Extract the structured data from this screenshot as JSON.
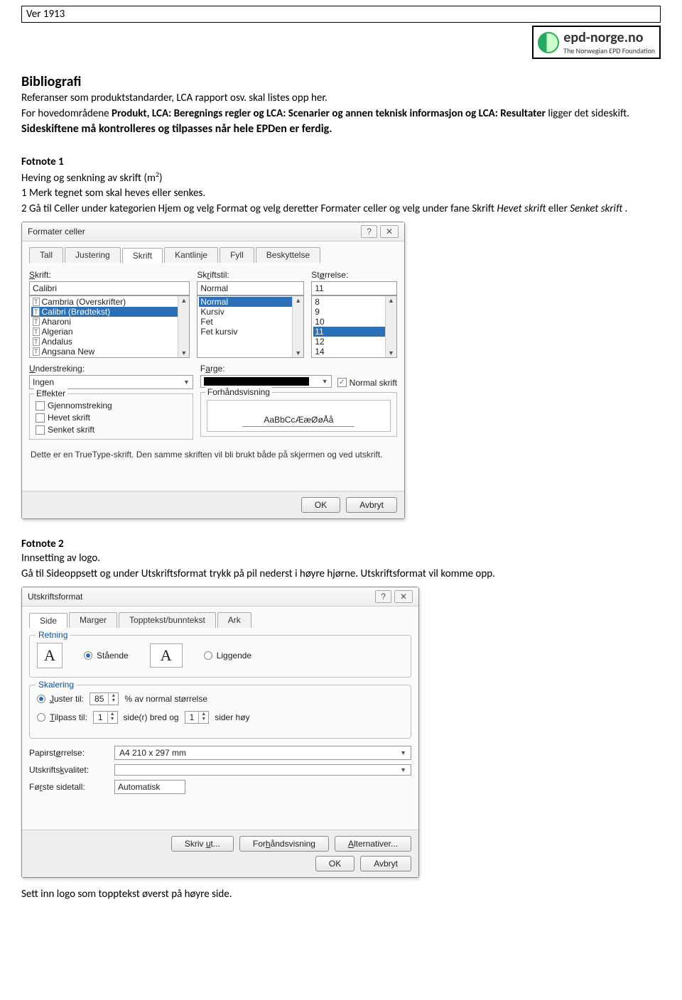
{
  "version": "Ver 1913",
  "logo": {
    "main": "epd-norge.no",
    "sub": "The Norwegian EPD Foundation"
  },
  "bibliografi": {
    "title": "Bibliografi",
    "p1": "Referanser som produktstandarder, LCA rapport osv. skal listes opp her.",
    "p2_a": "For hovedområdene ",
    "p2_b": "Produkt, LCA: Beregnings regler og LCA: Scenarier og annen teknisk informasjon og LCA: Resultater",
    "p2_c": " ligger det sideskift.",
    "boldline": "Sideskiftene må kontrolleres og tilpasses når hele EPDen er ferdig."
  },
  "fotnote1": {
    "title": "Fotnote 1",
    "line1_a": "Heving og senkning av skrift    (m",
    "line1_sup": "2",
    "line1_b": ")",
    "step1": "1 Merk tegnet som skal heves eller senkes.",
    "step2_a": "2 Gå til Celler under kategorien Hjem og velg Format og velg deretter Formater celler og velg under fane Skrift ",
    "step2_b": "Hevet skrift",
    "step2_c": "  eller ",
    "step2_d": "Senket skrift",
    "step2_e": " ."
  },
  "dialog1": {
    "title": "Formater celler",
    "tabs": {
      "tall": "Tall",
      "justering": "Justering",
      "skrift": "Skrift",
      "kantlinje": "Kantlinje",
      "fyll": "Fyll",
      "beskyttelse": "Beskyttelse"
    },
    "skrift_label": "Skrift:",
    "skrift_value": "Calibri",
    "font_list": [
      "Cambria (Overskrifter)",
      "Calibri (Brødtekst)",
      "Aharoni",
      "Algerian",
      "Andalus",
      "Angsana New"
    ],
    "skriftsil_label": "Skriftstil:",
    "skriftsil_value": "Normal",
    "style_list": [
      "Normal",
      "Kursiv",
      "Fet",
      "Fet kursiv"
    ],
    "storrelse_label": "Størrelse:",
    "storrelse_value": "11",
    "size_list": [
      "8",
      "9",
      "10",
      "11",
      "12",
      "14"
    ],
    "understreking": "Understreking:",
    "understreking_val": "Ingen",
    "farge": "Farge:",
    "normal_skrift": "Normal skrift",
    "effekter": "Effekter",
    "eff1": "Gjennomstreking",
    "eff2": "Hevet skrift",
    "eff3": "Senket skrift",
    "forhandsvisning": "Forhåndsvisning",
    "preview_text": "AaBbCcÆæØøÅå",
    "truetype": "Dette er en TrueType-skrift. Den samme skriften vil bli brukt både på skjermen og ved utskrift.",
    "ok": "OK",
    "avbryt": "Avbryt"
  },
  "fotnote2": {
    "title": "Fotnote 2",
    "line1": "Innsetting av logo.",
    "line2": "Gå til Sideoppsett og under Utskriftsformat trykk på pil nederst i høyre hjørne. Utskriftsformat vil komme opp."
  },
  "dialog2": {
    "title": "Utskriftsformat",
    "tabs": {
      "side": "Side",
      "marger": "Marger",
      "topp": "Topptekst/bunntekst",
      "ark": "Ark"
    },
    "retning": "Retning",
    "staende": "Stående",
    "liggende": "Liggende",
    "skalering": "Skalering",
    "juster_til": "Juster til:",
    "juster_val": "85",
    "juster_suffix": "% av normal størrelse",
    "tilpass_til": "Tilpass til:",
    "tilpass_a": "1",
    "tilpass_mid": "side(r) bred og",
    "tilpass_b": "1",
    "tilpass_suffix": "sider høy",
    "papir_label": "Papirstørrelse:",
    "papir_val": "A4 210 x 297 mm",
    "kval_label": "Utskriftskvalitet:",
    "kval_val": "",
    "first_label": "Første sidetall:",
    "first_val": "Automatisk",
    "skriv_ut": "Skriv ut...",
    "forhandsvisning": "Forhåndsvisning",
    "alternativer": "Alternativer...",
    "ok": "OK",
    "avbryt": "Avbryt"
  },
  "closing": "Sett inn logo som topptekst øverst på høyre side."
}
